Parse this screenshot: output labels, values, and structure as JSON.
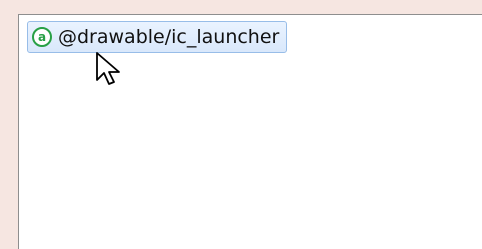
{
  "suggestion": {
    "badge_glyph": "a",
    "text": "@drawable/ic_launcher",
    "badge_color": "#28a046",
    "highlight_color": "#d9e8fb"
  },
  "cursor": {
    "icon": "arrow-pointer-icon"
  }
}
